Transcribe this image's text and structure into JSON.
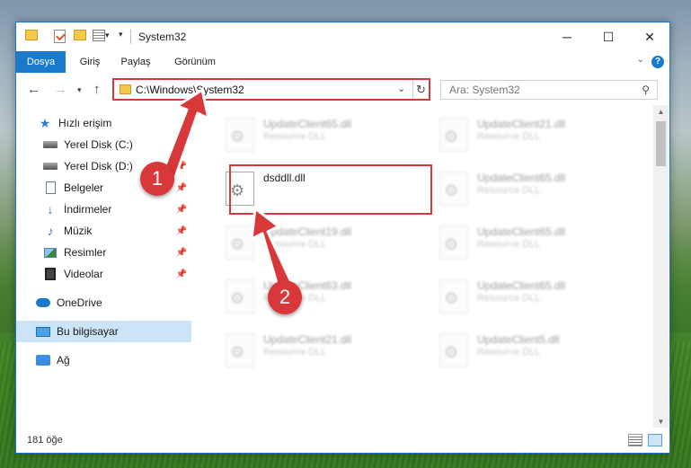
{
  "window": {
    "title": "System32",
    "controls": {
      "minimize": "─",
      "maximize": "☐",
      "close": "✕"
    }
  },
  "ribbon": {
    "tabs": [
      "Dosya",
      "Giriş",
      "Paylaş",
      "Görünüm"
    ],
    "help": "?"
  },
  "nav": {
    "address": "C:\\Windows\\System32",
    "search_placeholder": "Ara: System32"
  },
  "sidebar": {
    "items": [
      {
        "label": "Hızlı erişim",
        "icon": "star-icon"
      },
      {
        "label": "Yerel Disk (C:)",
        "icon": "drive-icon",
        "pinned": true
      },
      {
        "label": "Yerel Disk (D:)",
        "icon": "drive-icon",
        "pinned": true
      },
      {
        "label": "Belgeler",
        "icon": "documents-icon",
        "pinned": true
      },
      {
        "label": "İndirmeler",
        "icon": "download-icon",
        "pinned": true
      },
      {
        "label": "Müzik",
        "icon": "music-icon",
        "pinned": true
      },
      {
        "label": "Resimler",
        "icon": "pictures-icon",
        "pinned": true
      },
      {
        "label": "Videolar",
        "icon": "videos-icon",
        "pinned": true
      },
      {
        "label": "OneDrive",
        "icon": "onedrive-icon"
      },
      {
        "label": "Bu bilgisayar",
        "icon": "computer-icon",
        "selected": true
      },
      {
        "label": "Ağ",
        "icon": "network-icon"
      }
    ]
  },
  "files": [
    {
      "name": "UpdateClient65.dll",
      "type": "Resource DLL"
    },
    {
      "name": "UpdateClient21.dll",
      "type": "Resource DLL"
    },
    {
      "name": "dsddll.dll",
      "type": ""
    },
    {
      "name": "UpdateClient65.dll",
      "type": "Resource DLL"
    },
    {
      "name": "UpdateClient19.dll",
      "type": "Resource DLL"
    },
    {
      "name": "UpdateClient65.dll",
      "type": "Resource DLL"
    },
    {
      "name": "UpdateClient63.dll",
      "type": "Resource DLL"
    },
    {
      "name": "UpdateClient65.dll",
      "type": "Resource DLL"
    },
    {
      "name": "UpdateClient21.dll",
      "type": "Resource DLL"
    },
    {
      "name": "UpdateClient5.dll",
      "type": "Resource DLL"
    }
  ],
  "status": {
    "count": "181 öğe"
  },
  "callouts": {
    "one": "1",
    "two": "2",
    "accent_color": "#d8383a"
  }
}
